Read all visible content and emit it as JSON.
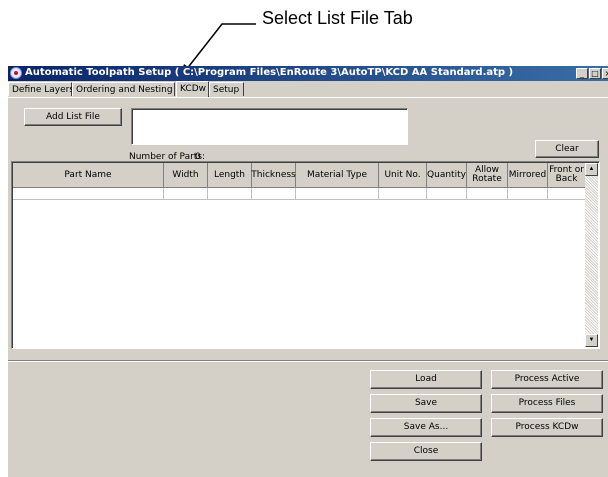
{
  "annotation": {
    "text": "Select List File Tab"
  },
  "window": {
    "title": "Automatic Toolpath Setup ( C:\\Program Files\\EnRoute 3\\AutoTP\\KCD AA Standard.atp )",
    "min_icon": "_",
    "max_icon": "□",
    "close_icon": "×"
  },
  "tabs": [
    {
      "label": "Define Layers",
      "active": false
    },
    {
      "label": "Ordering and Nesting",
      "active": false
    },
    {
      "label": "KCDw",
      "active": true
    },
    {
      "label": "Setup",
      "active": false
    }
  ],
  "buttons": {
    "add_list_file": "Add List File",
    "clear": "Clear",
    "load": "Load",
    "save": "Save",
    "save_as": "Save As...",
    "close": "Close",
    "process_active": "Process Active",
    "process_files": "Process Files",
    "process_kcdw": "Process KCDw"
  },
  "number_of_parts": {
    "label": "Number of Parts:",
    "value": "0"
  },
  "grid": {
    "columns": [
      "Part Name",
      "Width",
      "Length",
      "Thickness",
      "Material Type",
      "Unit No.",
      "Quantity",
      "Allow Rotate",
      "Mirrored",
      "Front or Back"
    ],
    "rows": []
  },
  "icons": {
    "app": "app-icon",
    "scroll_up": "▲",
    "scroll_down": "▼"
  }
}
